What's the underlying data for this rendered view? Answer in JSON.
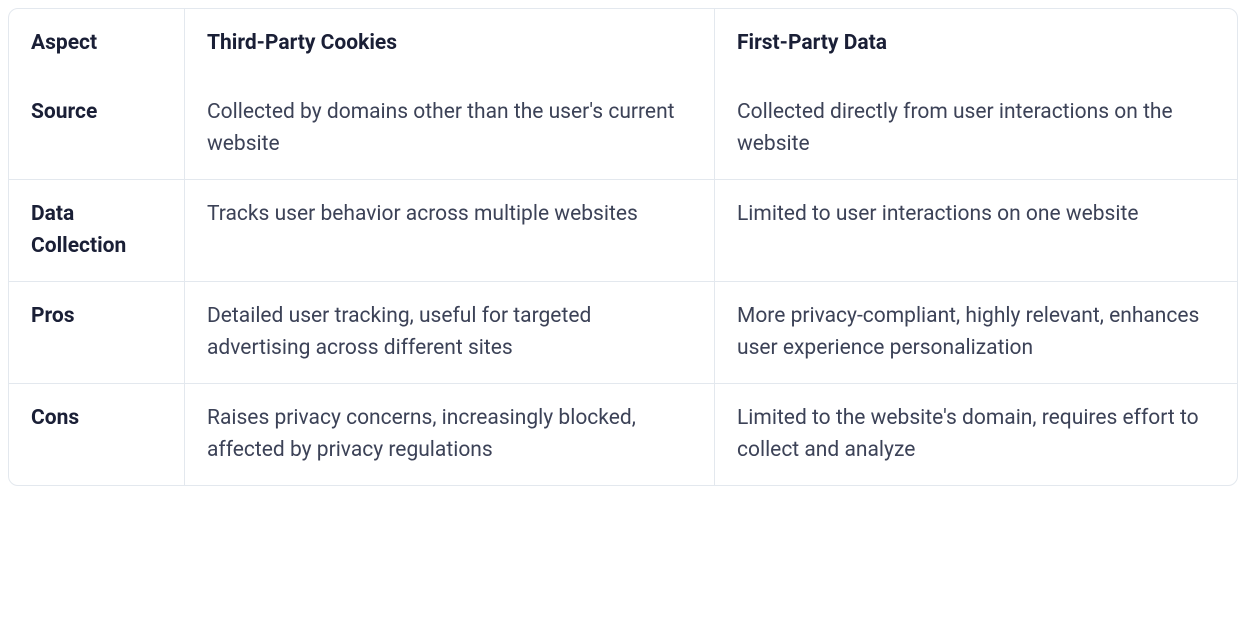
{
  "table": {
    "headers": {
      "aspect": "Aspect",
      "third_party": "Third-Party Cookies",
      "first_party": "First-Party Data"
    },
    "rows": [
      {
        "aspect": "Source",
        "third_party": "Collected by domains other than the user's current website",
        "first_party": "Collected directly from user interactions on the website"
      },
      {
        "aspect": "Data Collection",
        "third_party": "Tracks user behavior across multiple websites",
        "first_party": "Limited to user interactions on one website"
      },
      {
        "aspect": "Pros",
        "third_party": "Detailed user tracking, useful for targeted advertising across different sites",
        "first_party": "More privacy-compliant, highly relevant, enhances user experience personalization"
      },
      {
        "aspect": "Cons",
        "third_party": "Raises privacy concerns, increasingly blocked, affected by privacy regulations",
        "first_party": "Limited to the website's domain, requires effort to collect and analyze"
      }
    ]
  }
}
